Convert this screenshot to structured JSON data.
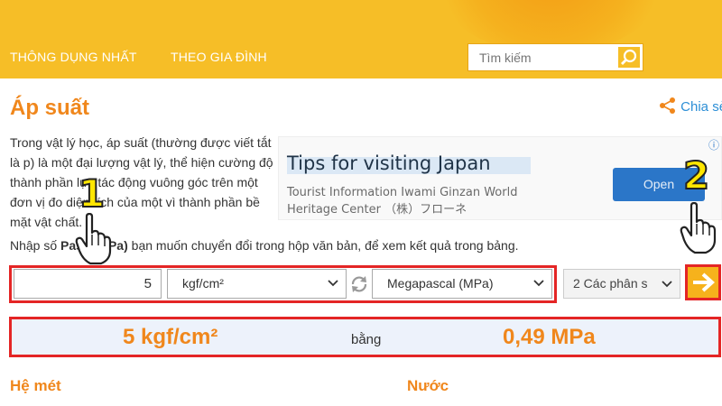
{
  "nav": {
    "items": [
      "THÔNG DỤNG NHẤT",
      "THEO GIA ĐÌNH"
    ],
    "search_placeholder": "Tìm kiếm"
  },
  "page": {
    "title": "Áp suất",
    "share_label": "Chia sẻ",
    "description": "Trong vật lý học, áp suất (thường được viết tắt là p) là một đại lượng vật lý, thể hiện cường độ thành phần lực tác động vuông góc trên một đơn vị đo diện tích của một vì thành phần bề mặt vật chất.",
    "instruction_pre": "Nhập số ",
    "instruction_bold": "Pascal (Pa)",
    "instruction_post": " bạn muốn chuyển đổi trong hộp văn bản, để xem kết quả trong bảng."
  },
  "ad": {
    "title": "Tips for visiting Japan",
    "subtitle": "Tourist Information Iwami Ginzan World Heritage Center （株）フローネ",
    "button": "Open",
    "info_icon": "ⓘ"
  },
  "converter": {
    "input_value": "5",
    "from_unit": "kgf/cm²",
    "to_unit": "Megapascal (MPa)",
    "decimals": "2 Các phân s"
  },
  "result": {
    "from": "5 kgf/cm²",
    "equals": "bằng",
    "to": "0,49 MPa"
  },
  "sections": [
    "Hệ mét",
    "Nước"
  ],
  "annotations": {
    "step1": "1",
    "step2": "2"
  },
  "colors": {
    "header": "#f6be27",
    "accent": "#f0871c",
    "highlight_border": "#e42525",
    "link": "#2d8fd6"
  }
}
